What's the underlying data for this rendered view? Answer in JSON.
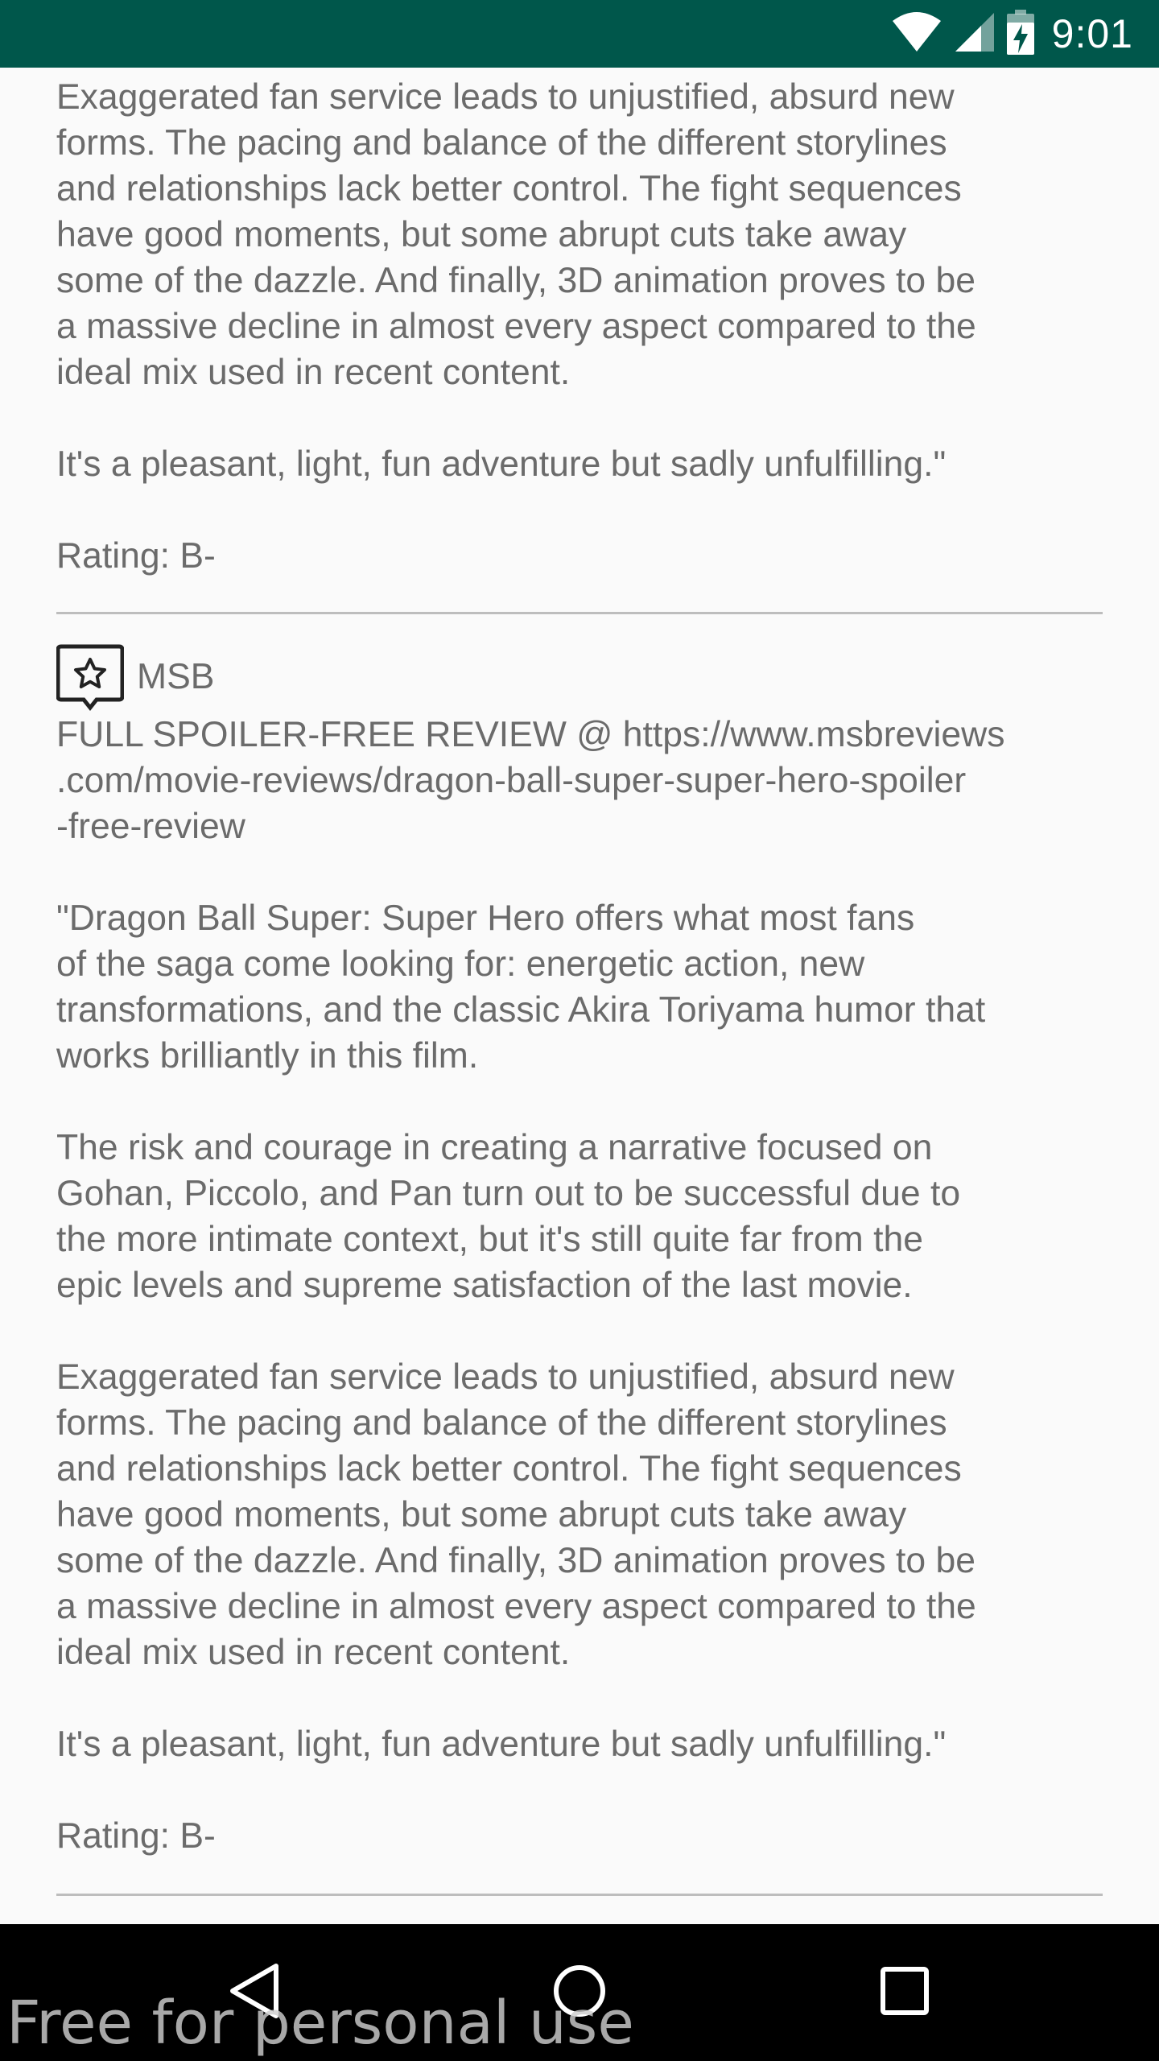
{
  "status_bar": {
    "time": "9:01",
    "icons": [
      "wifi-icon",
      "cell-signal-icon",
      "battery-charging-icon"
    ],
    "background": "#00574b"
  },
  "reviews": [
    {
      "partial": true,
      "body": "Exaggerated fan service leads to unjustified, absurd new\nforms. The pacing and balance of the different storylines\nand relationships lack better control. The fight sequences\nhave good moments, but some abrupt cuts take away\nsome of the dazzle. And finally, 3D animation proves to be\na massive decline in almost every aspect compared to the\nideal mix used in recent content.\n\nIt's a pleasant, light, fun adventure but sadly unfulfilling.\"\n\nRating: B-"
    },
    {
      "author": "MSB",
      "avatar_icon": "star-speech-bubble-icon",
      "body": "FULL SPOILER-FREE REVIEW @ https://www.msbreviews\n.com/movie-reviews/dragon-ball-super-super-hero-spoiler\n-free-review\n\n\"Dragon Ball Super: Super Hero offers what most fans\nof the saga come looking for: energetic action, new\ntransformations, and the classic Akira Toriyama humor that\nworks brilliantly in this film.\n\nThe risk and courage in creating a narrative focused on\nGohan, Piccolo, and Pan turn out to be successful due to\nthe more intimate context, but it's still quite far from the\nepic levels and supreme satisfaction of the last movie.\n\nExaggerated fan service leads to unjustified, absurd new\nforms. The pacing and balance of the different storylines\nand relationships lack better control. The fight sequences\nhave good moments, but some abrupt cuts take away\nsome of the dazzle. And finally, 3D animation proves to be\na massive decline in almost every aspect compared to the\nideal mix used in recent content.\n\nIt's a pleasant, light, fun adventure but sadly unfulfilling.\"\n\nRating: B-"
    }
  ],
  "nav_bar": {
    "buttons": [
      "back-icon",
      "home-icon",
      "recents-icon"
    ]
  },
  "watermark": "Free for personal use"
}
